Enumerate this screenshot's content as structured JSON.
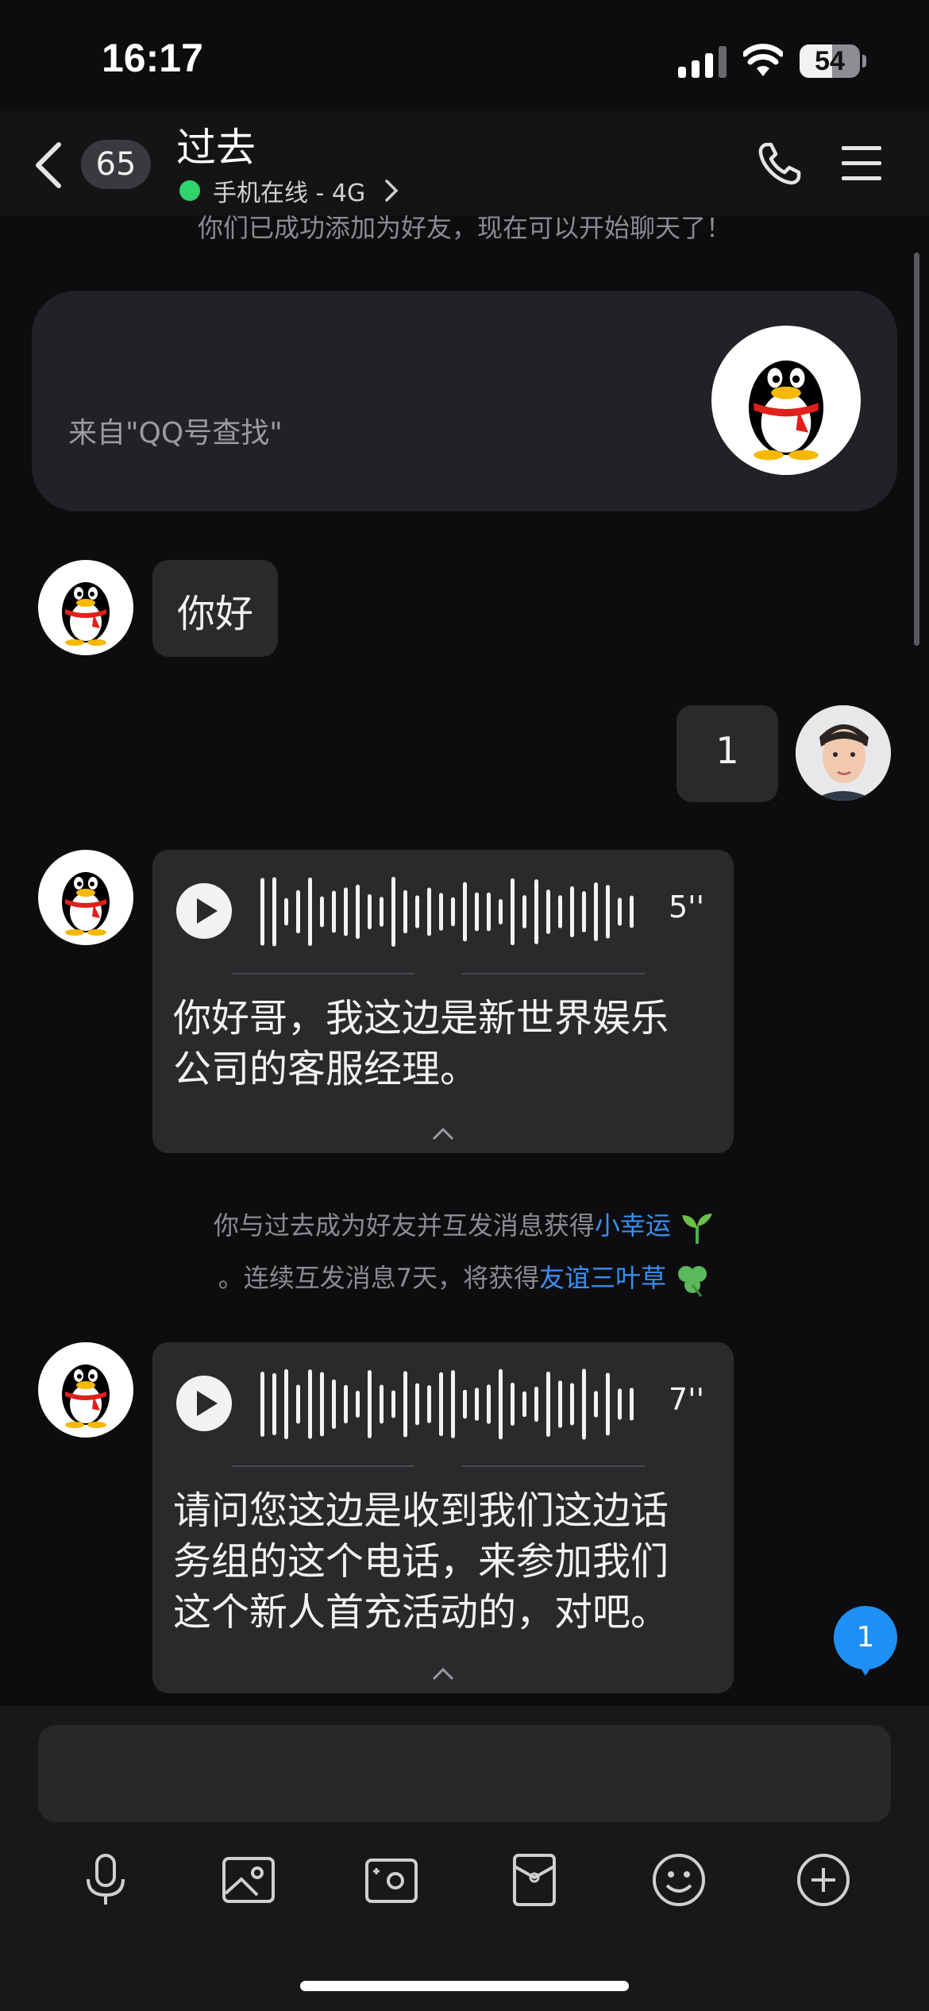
{
  "status_bar": {
    "time": "16:17",
    "battery_level": "54",
    "battery_fraction": 0.54
  },
  "header": {
    "unread_count": "65",
    "title": "过去",
    "online_status": "手机在线 - 4G"
  },
  "chat": {
    "system_friend_added": "你们已成功添加为好友，现在可以开始聊天了！",
    "source_card_label": "来自\"QQ号查找\"",
    "messages": {
      "hello": "你好",
      "one": "1",
      "voice1": {
        "duration": "5''",
        "transcript_line1": "你好哥，我这边是新世界娱乐",
        "transcript_line2": "公司的客服经理。"
      },
      "voice2": {
        "duration": "7''",
        "transcript_line1": "请问您这边是收到我们这边话",
        "transcript_line2": "务组的这个电话，来参加我们",
        "transcript_line3": "这个新人首充活动的，对吧。"
      }
    },
    "luck_notice": {
      "line1_text": "你与过去成为好友并互发消息获得",
      "line1_link": "小幸运",
      "line2_text": "。连续互发消息7天，将获得",
      "line2_link": "友谊三叶草"
    },
    "new_message_count": "1"
  },
  "input": {
    "placeholder": ""
  },
  "icons": {
    "back": "chevron-left-icon",
    "phone": "phone-icon",
    "menu": "menu-icon",
    "toolbar": [
      "microphone-icon",
      "image-icon",
      "camera-icon",
      "red-packet-icon",
      "emoji-icon",
      "plus-icon"
    ]
  },
  "colors": {
    "background": "#0d0d0f",
    "bubble": "#2a2a2d",
    "accent": "#1e90f5",
    "online": "#2fd46b",
    "link": "#3a8ff0"
  }
}
